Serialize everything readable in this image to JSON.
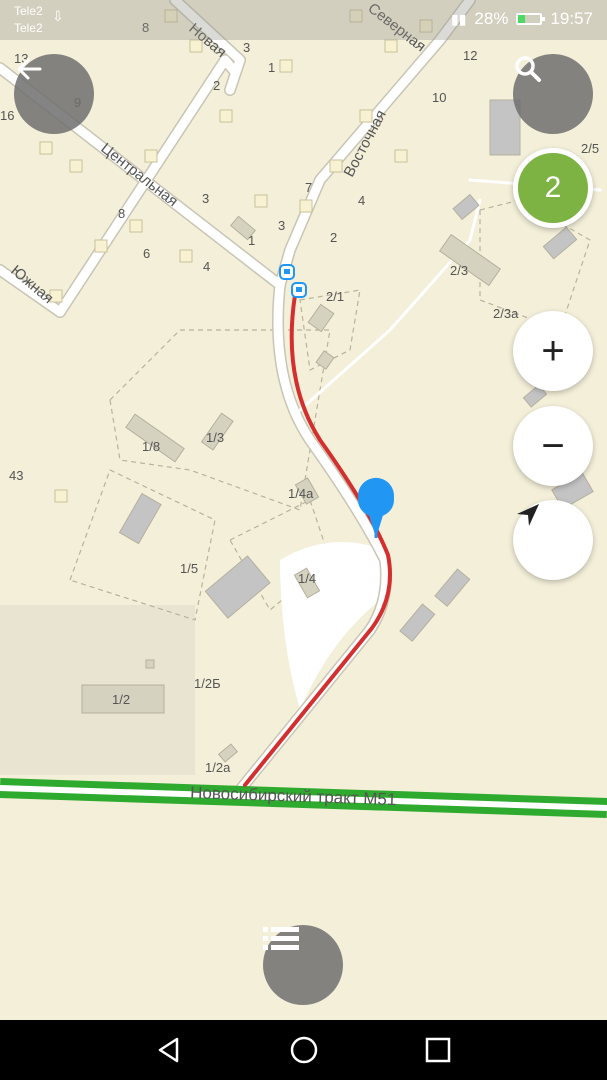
{
  "status_bar": {
    "carrier_1": "Tele2",
    "carrier_2": "Tele2",
    "battery_percent": "28%",
    "battery_level": 0.28,
    "time": "19:57"
  },
  "map": {
    "street_labels": {
      "novaya": "Новая",
      "severnaya": "Северная",
      "vostochnaya": "Восточная",
      "tsentralnaya": "Центральная",
      "yuzhnaya": "Южная",
      "highway": "Новосибирский тракт М51"
    },
    "house_numbers": {
      "n13": "13",
      "n16": "16",
      "n8a": "8",
      "n9": "9",
      "n3a": "3",
      "n2a": "2",
      "n1a": "1",
      "n12": "12",
      "n10": "10",
      "n7": "7",
      "n4a": "4",
      "n3b": "3",
      "n1b": "1",
      "n2b": "2",
      "n3c": "3",
      "n8b": "8",
      "n6": "6",
      "n4b": "4",
      "n2_5": "2/5",
      "n2_3": "2/3",
      "n2_3a": "2/3а",
      "n2_1": "2/1",
      "n1_8": "1/8",
      "n1_3": "1/3",
      "n43": "43",
      "n1_4a": "1/4а",
      "n1_5": "1/5",
      "n1_4": "1/4",
      "n1_2b": "1/2Б",
      "n1_2": "1/2",
      "n1_2a": "1/2а"
    },
    "route_color": "#d32f2f",
    "highway_color": "#2eaa2e",
    "pin_color": "#2196f3"
  },
  "controls": {
    "back_icon": "arrow-left-icon",
    "search_icon": "search-icon",
    "cluster_count": "2",
    "zoom_in_label": "+",
    "zoom_out_label": "−",
    "locate_icon": "navigation-arrow-icon",
    "list_icon": "list-icon"
  },
  "nav_bar": {
    "back": "triangle-back-icon",
    "home": "circle-home-icon",
    "recents": "square-recents-icon"
  }
}
